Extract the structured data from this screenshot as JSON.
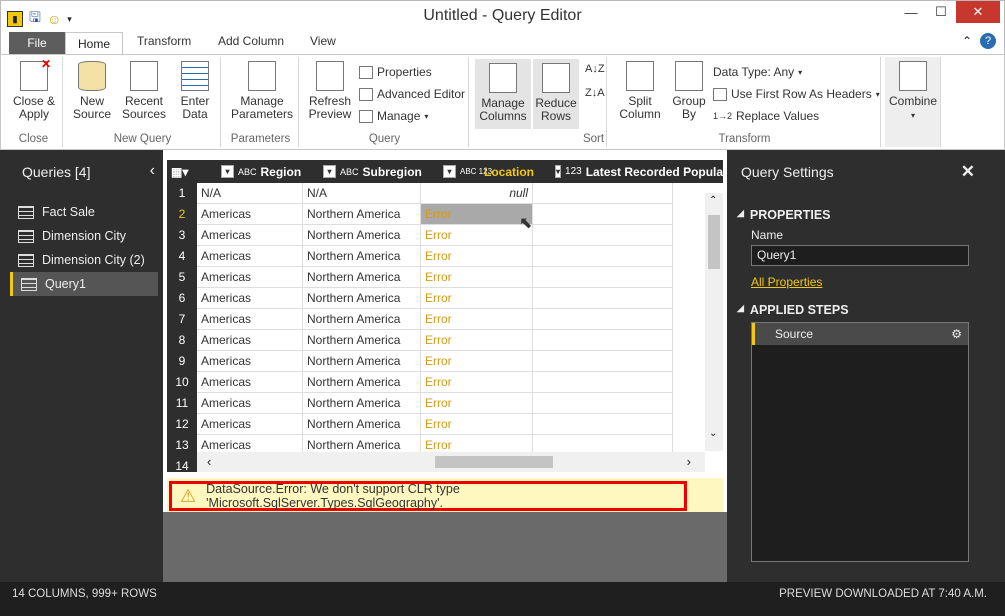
{
  "window": {
    "title": "Untitled - Query Editor"
  },
  "tabs": {
    "file": "File",
    "home": "Home",
    "transform": "Transform",
    "add_column": "Add Column",
    "view": "View"
  },
  "ribbon": {
    "close_apply": "Close &\nApply",
    "new_source": "New\nSource",
    "recent_sources": "Recent\nSources",
    "enter_data": "Enter\nData",
    "manage_parameters": "Manage\nParameters",
    "refresh_preview": "Refresh\nPreview",
    "properties": "Properties",
    "advanced_editor": "Advanced Editor",
    "manage": "Manage",
    "manage_columns": "Manage\nColumns",
    "reduce_rows": "Reduce\nRows",
    "split_column": "Split\nColumn",
    "group_by": "Group\nBy",
    "data_type": "Data Type: Any",
    "use_first_row": "Use First Row As Headers",
    "replace_values": "Replace Values",
    "combine": "Combine",
    "groups": {
      "close": "Close",
      "new_query": "New Query",
      "parameters": "Parameters",
      "query": "Query",
      "sort": "Sort",
      "transform": "Transform"
    }
  },
  "queries": {
    "title": "Queries [4]",
    "items": [
      {
        "label": "Fact Sale",
        "selected": false
      },
      {
        "label": "Dimension City",
        "selected": false
      },
      {
        "label": "Dimension City (2)",
        "selected": false
      },
      {
        "label": "Query1",
        "selected": true
      }
    ]
  },
  "grid": {
    "columns": [
      {
        "type": "ABC",
        "label": "Region"
      },
      {
        "type": "ABC",
        "label": "Subregion"
      },
      {
        "type": "ABC 123",
        "label": "Location"
      },
      {
        "type": "123",
        "label": "Latest Recorded Populatio"
      }
    ],
    "rows": [
      {
        "n": "1",
        "region": "N/A",
        "subregion": "N/A",
        "location": "null"
      },
      {
        "n": "2",
        "region": "Americas",
        "subregion": "Northern America",
        "location": "Error"
      },
      {
        "n": "3",
        "region": "Americas",
        "subregion": "Northern America",
        "location": "Error"
      },
      {
        "n": "4",
        "region": "Americas",
        "subregion": "Northern America",
        "location": "Error"
      },
      {
        "n": "5",
        "region": "Americas",
        "subregion": "Northern America",
        "location": "Error"
      },
      {
        "n": "6",
        "region": "Americas",
        "subregion": "Northern America",
        "location": "Error"
      },
      {
        "n": "7",
        "region": "Americas",
        "subregion": "Northern America",
        "location": "Error"
      },
      {
        "n": "8",
        "region": "Americas",
        "subregion": "Northern America",
        "location": "Error"
      },
      {
        "n": "9",
        "region": "Americas",
        "subregion": "Northern America",
        "location": "Error"
      },
      {
        "n": "10",
        "region": "Americas",
        "subregion": "Northern America",
        "location": "Error"
      },
      {
        "n": "11",
        "region": "Americas",
        "subregion": "Northern America",
        "location": "Error"
      },
      {
        "n": "12",
        "region": "Americas",
        "subregion": "Northern America",
        "location": "Error"
      },
      {
        "n": "13",
        "region": "Americas",
        "subregion": "Northern America",
        "location": "Error"
      },
      {
        "n": "14",
        "region": "",
        "subregion": "",
        "location": ""
      }
    ]
  },
  "error": {
    "message": "DataSource.Error: We don't support CLR type 'Microsoft.SqlServer.Types.SqlGeography'."
  },
  "settings": {
    "title": "Query Settings",
    "properties_label": "PROPERTIES",
    "name_label": "Name",
    "name_value": "Query1",
    "all_properties": "All Properties",
    "applied_steps_label": "APPLIED STEPS",
    "steps": [
      "Source"
    ]
  },
  "status": {
    "left": "14 COLUMNS, 999+ ROWS",
    "right": "PREVIEW DOWNLOADED AT 7:40 A.M."
  },
  "colors": {
    "accent": "#f2c811",
    "error_text": "#d49b1a",
    "error_border": "#ee0000"
  }
}
